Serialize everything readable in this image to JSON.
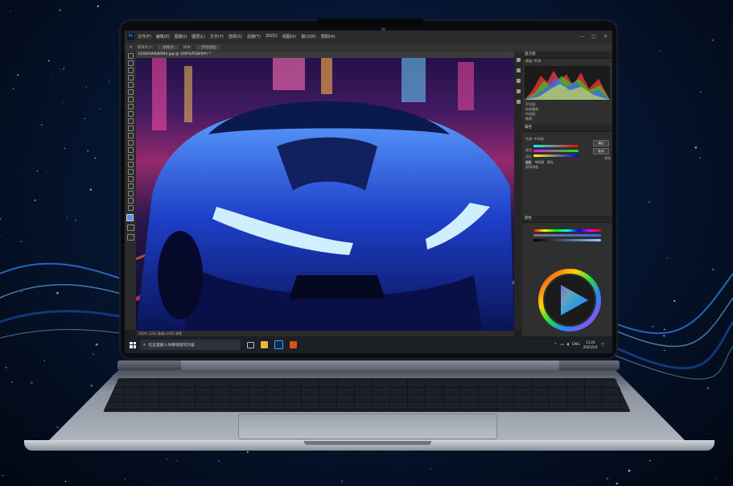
{
  "window": {
    "app_icon": "Ps",
    "menus": [
      "文件(F)",
      "编辑(E)",
      "图像(I)",
      "图层(L)",
      "文字(Y)",
      "选择(S)",
      "滤镜(T)",
      "3D(D)",
      "视图(V)",
      "窗口(W)",
      "帮助(H)"
    ],
    "controls": [
      "—",
      "□",
      "✕"
    ]
  },
  "document": {
    "tab_label": "k5Q4HW8jBXN3.jpg @ 100%(RGB/8#) *",
    "status": "100%    1332 像素x1002 像素"
  },
  "options_bar": {
    "items": [
      "取样大小:",
      "取样点",
      "样本:",
      "所有图层"
    ]
  },
  "panels": {
    "histogram_title": "直方图",
    "histogram_channel": "通道: RGB",
    "histogram_stats": [
      "平均值:",
      "标准偏差:",
      "中间值:",
      "像素:"
    ],
    "props_title": "属性",
    "color_balance_label": "色调: 中间调",
    "sliders": [
      "青色",
      "洋红",
      "黄色"
    ],
    "buttons": [
      "确定",
      "取消"
    ],
    "preview_label": "预览",
    "checks": [
      "阴影",
      "中间调",
      "高光"
    ],
    "keep_luminosity": "保持明度",
    "color_title": "颜色"
  },
  "taskbar": {
    "search_placeholder": "在这里输入你要搜索的内容",
    "lang": "ENG",
    "time": "13:26",
    "date": "2025/5/4"
  },
  "colors": {
    "accent": "#31a8ff",
    "taskbar": "#1c1f26"
  }
}
